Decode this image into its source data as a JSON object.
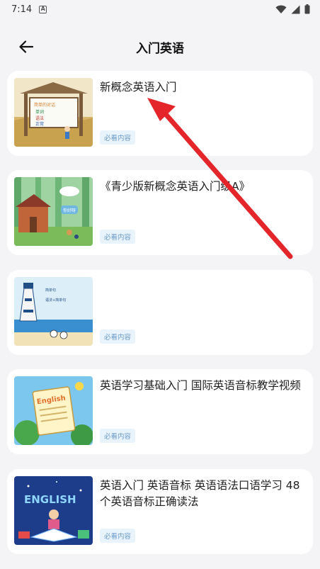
{
  "status": {
    "time": "7:14",
    "notif_letter": "A"
  },
  "header": {
    "title": "入门英语",
    "back_icon": "arrow-left-icon"
  },
  "tag_label": "必看内容",
  "items": [
    {
      "title": "新概念英语入门",
      "thumb_text": [
        "简单的对话",
        "单词",
        "语法",
        "正常"
      ]
    },
    {
      "title": "《青少版新概念英语入门级A》",
      "thumb_text": [
        "你好呀"
      ]
    },
    {
      "title": "",
      "thumb_text": [
        "简单句",
        "语法+简单句"
      ]
    },
    {
      "title": "英语学习基础入门 国际英语音标教学视频",
      "thumb_text": [
        "English"
      ]
    },
    {
      "title": "英语入门 英语音标 英语语法口语学习 48个英语音标正确读法",
      "thumb_text": [
        "ENGLISH"
      ]
    }
  ],
  "colors": {
    "arrow": "#e4262b",
    "tag_bg": "#e9f3fc",
    "tag_text": "#6a9bc9",
    "page_bg": "#f4f4f6"
  }
}
